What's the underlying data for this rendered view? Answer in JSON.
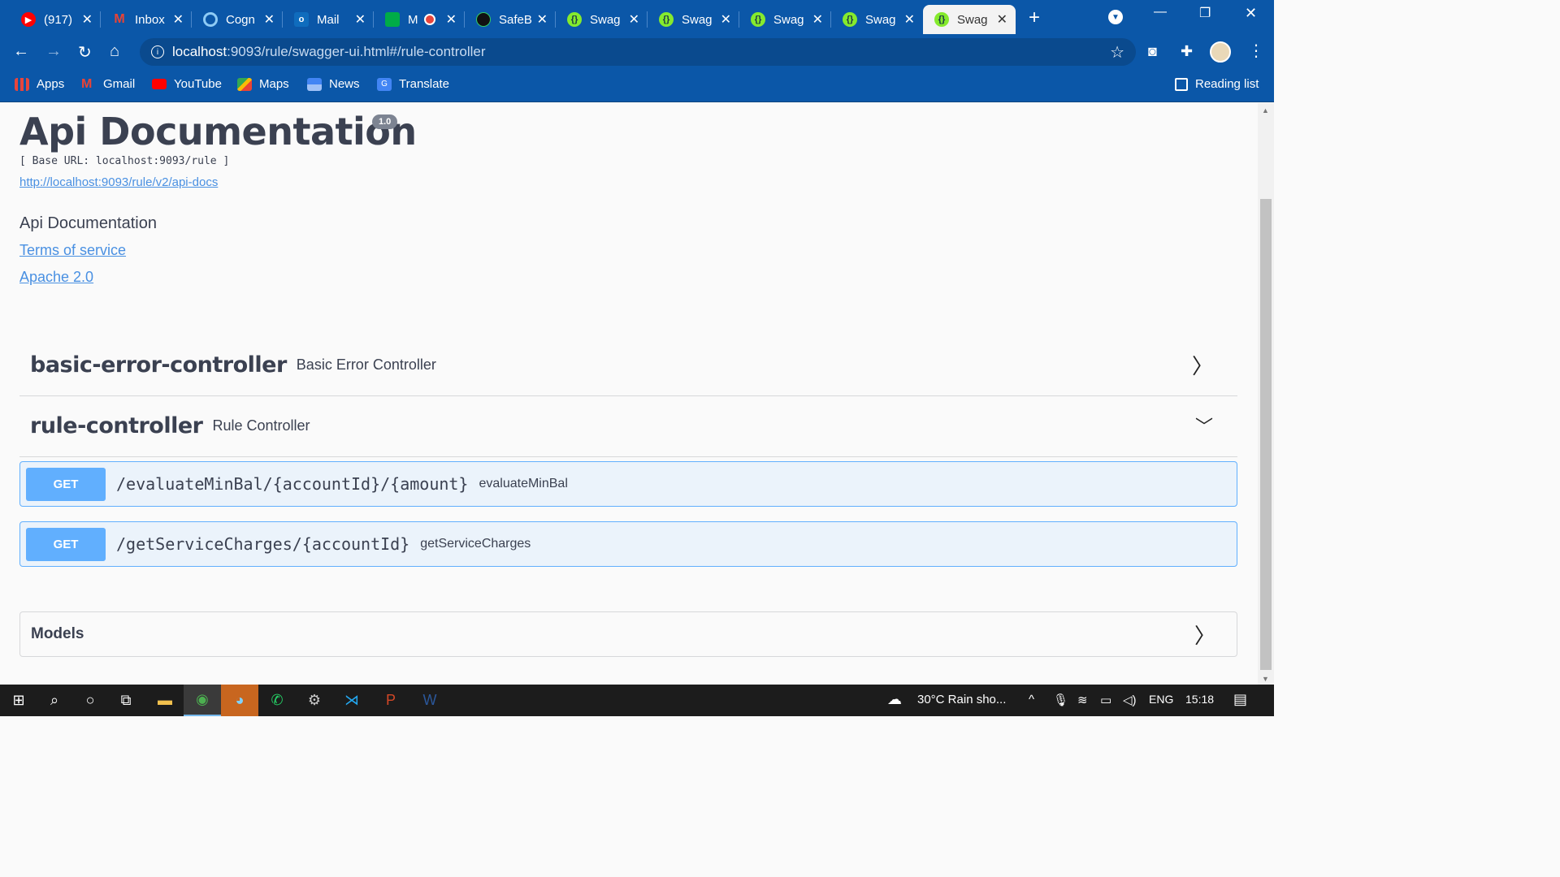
{
  "tabs": [
    {
      "title": "(917)",
      "favicon": "youtube-icon",
      "color": "#ff0000"
    },
    {
      "title": "Inbox",
      "favicon": "gmail-icon",
      "color": "#ea4335"
    },
    {
      "title": "Cogn",
      "favicon": "webex-icon",
      "color": "#8ecbf5"
    },
    {
      "title": "Mail",
      "favicon": "outlook-icon",
      "color": "#0f6cbd"
    },
    {
      "title": "M",
      "favicon": "meet-icon",
      "color": "#00ac47"
    },
    {
      "title": "SafeB",
      "favicon": "safe-icon",
      "color": "#111111"
    },
    {
      "title": "Swag",
      "favicon": "swagger-icon",
      "color": "#85ea2d"
    },
    {
      "title": "Swag",
      "favicon": "swagger-icon",
      "color": "#85ea2d"
    },
    {
      "title": "Swag",
      "favicon": "swagger-icon",
      "color": "#85ea2d"
    },
    {
      "title": "Swag",
      "favicon": "swagger-icon",
      "color": "#85ea2d"
    },
    {
      "title": "Swag",
      "favicon": "swagger-icon",
      "color": "#85ea2d"
    }
  ],
  "address": {
    "host": "localhost",
    "path": ":9093/rule/swagger-ui.html#/rule-controller"
  },
  "bookmarks": [
    {
      "label": "Apps",
      "icon": "apps-grid-icon",
      "color": "#e8453c"
    },
    {
      "label": "Gmail",
      "icon": "gmail-icon",
      "color": "#ea4335"
    },
    {
      "label": "YouTube",
      "icon": "youtube-icon",
      "color": "#ff0000"
    },
    {
      "label": "Maps",
      "icon": "maps-icon",
      "color": "#34a853"
    },
    {
      "label": "News",
      "icon": "news-icon",
      "color": "#4285f4"
    },
    {
      "label": "Translate",
      "icon": "translate-icon",
      "color": "#4285f4"
    }
  ],
  "reading_list": "Reading list",
  "info": {
    "title": "Api Documentation",
    "version": "1.0",
    "base_url": "[ Base URL: localhost:9093/rule ]",
    "api_docs_link": "http://localhost:9093/rule/v2/api-docs",
    "description": "Api Documentation",
    "terms": "Terms of service",
    "license": "Apache 2.0"
  },
  "controllers": [
    {
      "name": "basic-error-controller",
      "description": "Basic Error Controller",
      "expanded": false
    },
    {
      "name": "rule-controller",
      "description": "Rule Controller",
      "expanded": true
    }
  ],
  "operations": [
    {
      "method": "GET",
      "path": "/evaluateMinBal/{accountId}/{amount}",
      "summary": "evaluateMinBal"
    },
    {
      "method": "GET",
      "path": "/getServiceCharges/{accountId}",
      "summary": "getServiceCharges"
    }
  ],
  "models_label": "Models",
  "taskbar": {
    "weather": "30°C  Rain sho...",
    "language": "ENG",
    "time": "15:18"
  },
  "colors": {
    "chrome": "#0b57a8",
    "get": "#61affe",
    "get_bg": "#ebf3fb"
  }
}
